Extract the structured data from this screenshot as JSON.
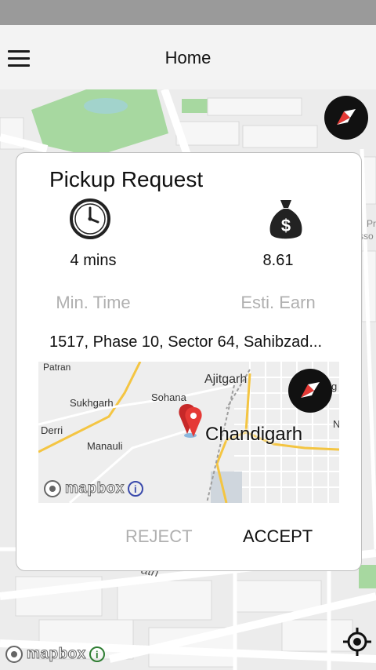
{
  "app": {
    "title": "Home"
  },
  "map": {
    "labels": {
      "road": "ath",
      "poi": "Pr",
      "poi2": "sso"
    },
    "attribution": "mapbox"
  },
  "dialog": {
    "title": "Pickup Request",
    "time": {
      "value": "4 mins",
      "label": "Min. Time"
    },
    "earn": {
      "value": "8.61",
      "label": "Esti. Earn"
    },
    "address": "1517, Phase 10, Sector 64, Sahibzad...",
    "minimap": {
      "places": {
        "patran": "Patran",
        "ajitgarh": "Ajitgarh",
        "sohana": "Sohana",
        "sukhgarh": "Sukhgarh",
        "derri": "Derri",
        "manauli": "Manauli",
        "chandigarh": "Chandigarh",
        "edge_n": "N",
        "edge_g": "g"
      },
      "attribution": "mapbox"
    },
    "reject_label": "REJECT",
    "accept_label": "ACCEPT"
  },
  "colors": {
    "accent_red": "#e53935",
    "map_bg": "#ededed",
    "park_green": "#a7d8a0",
    "road_yellow": "#f4c542",
    "label_gray": "#b0b0b0"
  },
  "icons": {
    "menu": "hamburger-icon",
    "compass": "compass-icon",
    "clock": "clock-icon",
    "money": "money-bag-icon",
    "pin": "map-pin-icon",
    "locate": "gps-locate-icon",
    "info": "info-icon"
  }
}
